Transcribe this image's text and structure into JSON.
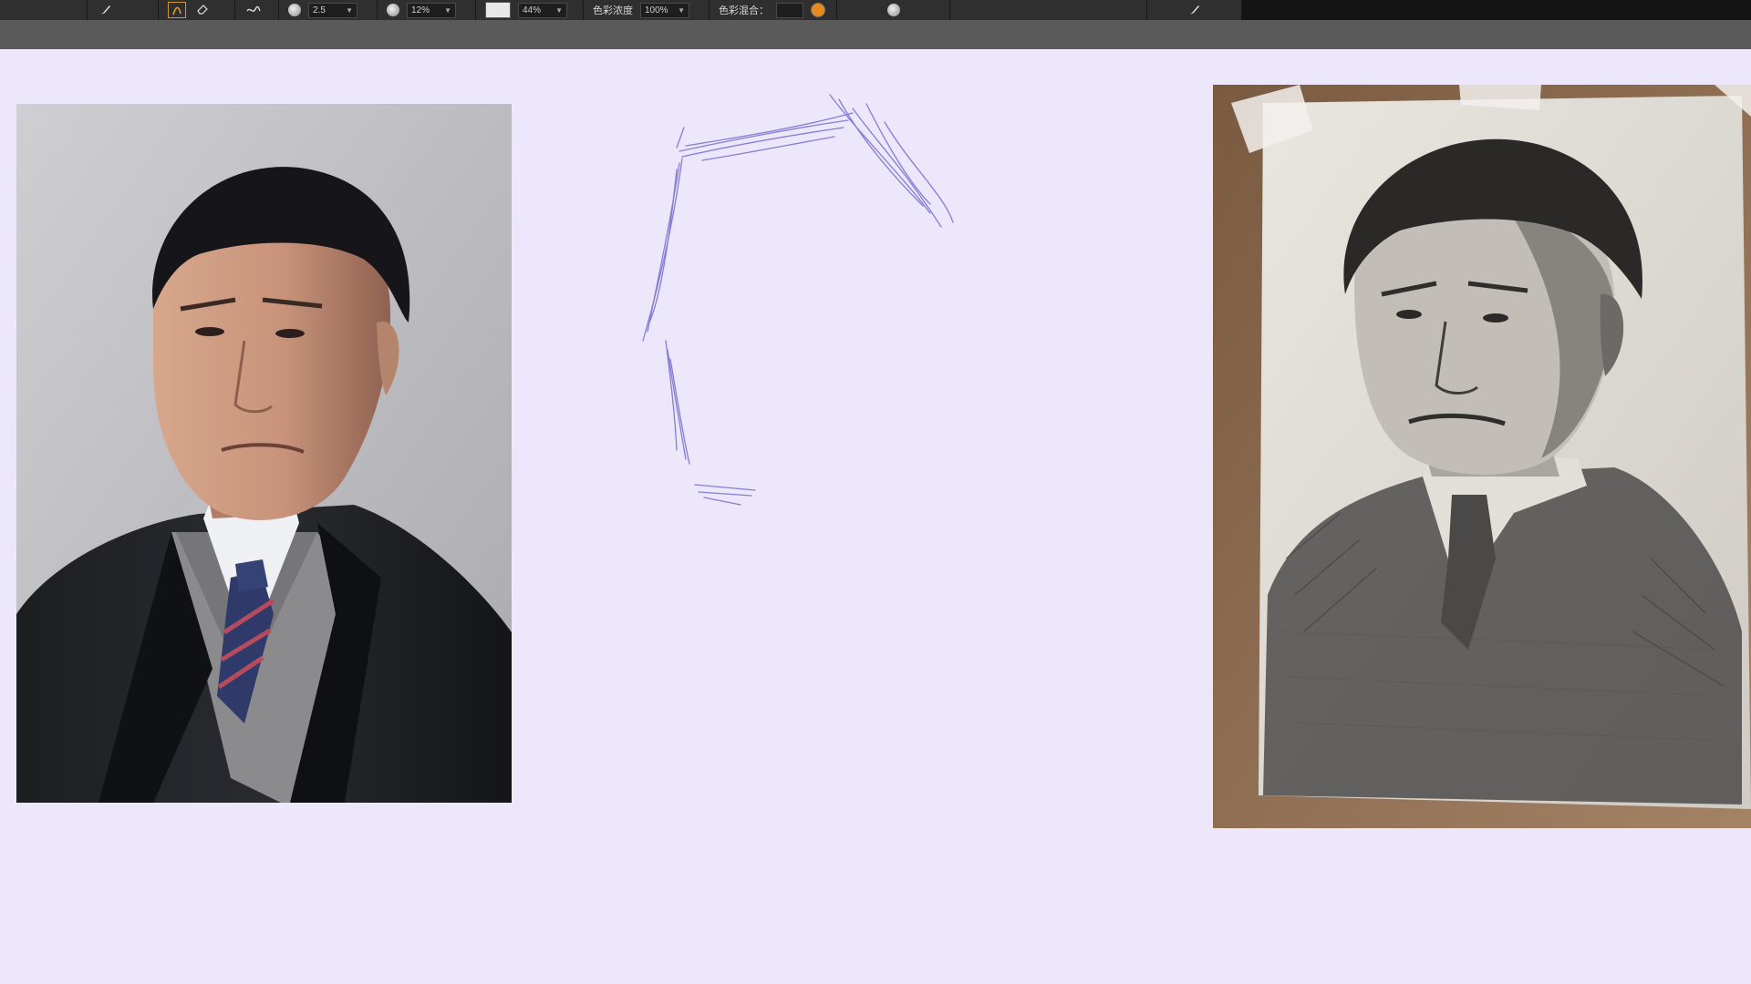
{
  "toolbar": {
    "tools": [
      {
        "icon": "brush-icon"
      },
      {
        "icon": "pen-pressure-icon",
        "active": true
      },
      {
        "icon": "eraser-icon"
      },
      {
        "icon": "stroke-smoothing-icon"
      }
    ],
    "brush_size": {
      "icon": "brush-size-icon",
      "value": "2.5"
    },
    "opacity": {
      "icon": "opacity-icon",
      "value": "12%"
    },
    "density": {
      "value": "44%"
    },
    "color_density": {
      "label": "色彩浓度",
      "value": "100%"
    },
    "color_mix": {
      "label": "色彩混合："
    },
    "accent_color": "#e58a1c"
  },
  "canvas": {
    "background_color": "#ece7fa",
    "sketch_color": "#7b72d0"
  },
  "images": {
    "reference_photo": {
      "subject": "portrait photo of man in suit and tie"
    },
    "charcoal_drawing": {
      "subject": "charcoal portrait drawing taped to board"
    }
  }
}
